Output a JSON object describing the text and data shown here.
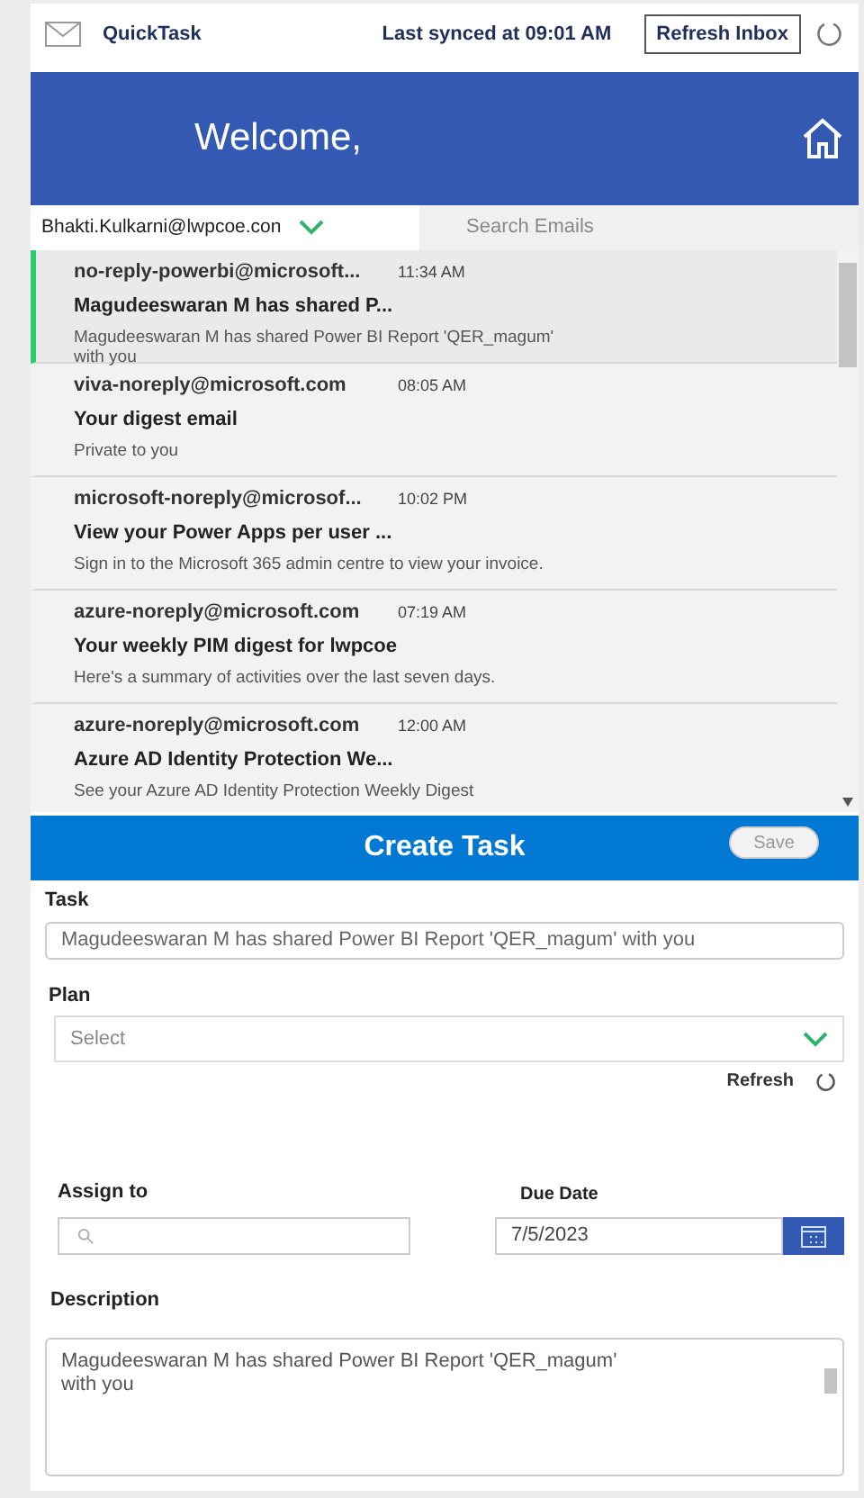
{
  "header": {
    "app_name": "QuickTask",
    "sync_status": "Last synced at 09:01 AM",
    "refresh_button": "Refresh Inbox"
  },
  "banner": {
    "greeting": "Welcome,"
  },
  "account_selector": {
    "value": "Bhakti.Kulkarni@lwpcoe.con"
  },
  "search": {
    "placeholder": "Search Emails"
  },
  "emails": [
    {
      "sender": "no-reply-powerbi@microsoft...",
      "time": "11:34 AM",
      "subject": "Magudeeswaran M has shared P...",
      "preview": "Magudeeswaran M has shared Power BI Report 'QER_magum' with you",
      "selected": true
    },
    {
      "sender": "viva-noreply@microsoft.com",
      "time": "08:05 AM",
      "subject": "Your digest email",
      "preview": "Private to you",
      "selected": false
    },
    {
      "sender": "microsoft-noreply@microsof...",
      "time": "10:02 PM",
      "subject": "View your Power Apps per user ...",
      "preview": "Sign in to the Microsoft 365 admin centre to view your invoice.",
      "selected": false
    },
    {
      "sender": "azure-noreply@microsoft.com",
      "time": "07:19 AM",
      "subject": "Your weekly PIM digest for lwpcoe",
      "preview": "Here's a summary of activities over the last seven days.",
      "selected": false
    },
    {
      "sender": "azure-noreply@microsoft.com",
      "time": "12:00 AM",
      "subject": "Azure AD Identity Protection We...",
      "preview": "See your Azure AD Identity Protection Weekly Digest",
      "selected": false
    }
  ],
  "form": {
    "title": "Create Task",
    "save_button": "Save",
    "save_disabled": true,
    "task": {
      "label": "Task",
      "value": "Magudeeswaran M has shared Power BI Report 'QER_magum' with you"
    },
    "plan": {
      "label": "Plan",
      "placeholder": "Select",
      "refresh": "Refresh"
    },
    "assign_to": {
      "label": "Assign to"
    },
    "due_date": {
      "label": "Due Date",
      "value": "7/5/2023"
    },
    "description": {
      "label": "Description",
      "value": "Magudeeswaran M has shared Power BI Report 'QER_magum' with you"
    }
  }
}
